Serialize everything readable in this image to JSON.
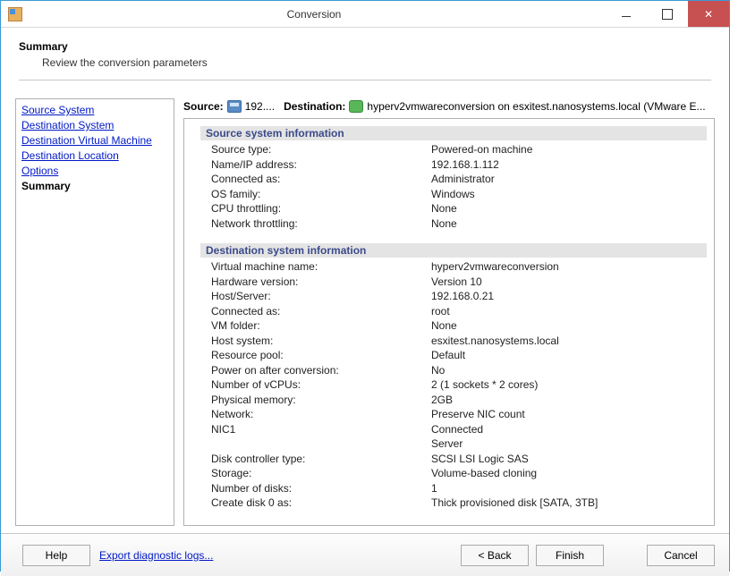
{
  "window": {
    "title": "Conversion"
  },
  "header": {
    "title": "Summary",
    "subtitle": "Review the conversion parameters"
  },
  "sidebar": {
    "items": [
      {
        "label": "Source System"
      },
      {
        "label": "Destination System"
      },
      {
        "label": "Destination Virtual Machine"
      },
      {
        "label": "Destination Location"
      },
      {
        "label": "Options"
      },
      {
        "label": "Summary"
      }
    ]
  },
  "srcdest": {
    "source_label": "Source:",
    "source_value": "192....",
    "dest_label": "Destination:",
    "dest_value": "hyperv2vmwareconversion on esxitest.nanosystems.local (VMware E..."
  },
  "sections": {
    "source": {
      "title": "Source system information",
      "rows": [
        {
          "k": "Source type:",
          "v": "Powered-on machine"
        },
        {
          "k": "Name/IP address:",
          "v": "192.168.1.112"
        },
        {
          "k": "Connected as:",
          "v": "Administrator"
        },
        {
          "k": "OS family:",
          "v": "Windows"
        },
        {
          "k": "CPU throttling:",
          "v": "None"
        },
        {
          "k": "Network throttling:",
          "v": "None"
        }
      ]
    },
    "dest": {
      "title": "Destination system information",
      "rows": [
        {
          "k": "Virtual machine name:",
          "v": "hyperv2vmwareconversion"
        },
        {
          "k": "Hardware version:",
          "v": "Version 10"
        },
        {
          "k": "Host/Server:",
          "v": "192.168.0.21"
        },
        {
          "k": "Connected as:",
          "v": "root"
        },
        {
          "k": "VM folder:",
          "v": "None"
        },
        {
          "k": "Host system:",
          "v": "esxitest.nanosystems.local"
        },
        {
          "k": "Resource pool:",
          "v": "Default"
        },
        {
          "k": "Power on after conversion:",
          "v": "No"
        },
        {
          "k": "Number of vCPUs:",
          "v": "2 (1 sockets * 2 cores)"
        },
        {
          "k": "Physical memory:",
          "v": "2GB"
        },
        {
          "k": "Network:",
          "v": "Preserve NIC count"
        },
        {
          "k": "NIC1",
          "v": "Connected"
        },
        {
          "k": "",
          "v": "Server"
        },
        {
          "k": "Disk controller type:",
          "v": "SCSI LSI Logic SAS"
        },
        {
          "k": "Storage:",
          "v": "Volume-based cloning"
        },
        {
          "k": "Number of disks:",
          "v": "1"
        },
        {
          "k": "Create disk 0 as:",
          "v": "Thick provisioned disk [SATA, 3TB]"
        }
      ]
    }
  },
  "footer": {
    "help": "Help",
    "export": "Export diagnostic logs...",
    "back": "< Back",
    "finish": "Finish",
    "cancel": "Cancel"
  }
}
